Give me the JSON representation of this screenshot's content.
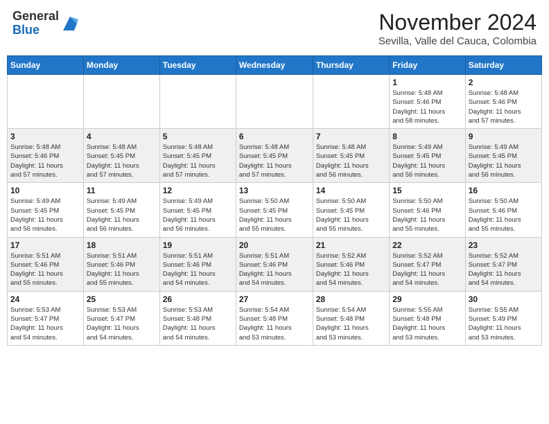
{
  "header": {
    "logo_line1": "General",
    "logo_line2": "Blue",
    "month": "November 2024",
    "location": "Sevilla, Valle del Cauca, Colombia"
  },
  "weekdays": [
    "Sunday",
    "Monday",
    "Tuesday",
    "Wednesday",
    "Thursday",
    "Friday",
    "Saturday"
  ],
  "weeks": [
    [
      {
        "day": "",
        "info": ""
      },
      {
        "day": "",
        "info": ""
      },
      {
        "day": "",
        "info": ""
      },
      {
        "day": "",
        "info": ""
      },
      {
        "day": "",
        "info": ""
      },
      {
        "day": "1",
        "info": "Sunrise: 5:48 AM\nSunset: 5:46 PM\nDaylight: 11 hours\nand 58 minutes."
      },
      {
        "day": "2",
        "info": "Sunrise: 5:48 AM\nSunset: 5:46 PM\nDaylight: 11 hours\nand 57 minutes."
      }
    ],
    [
      {
        "day": "3",
        "info": "Sunrise: 5:48 AM\nSunset: 5:46 PM\nDaylight: 11 hours\nand 57 minutes."
      },
      {
        "day": "4",
        "info": "Sunrise: 5:48 AM\nSunset: 5:45 PM\nDaylight: 11 hours\nand 57 minutes."
      },
      {
        "day": "5",
        "info": "Sunrise: 5:48 AM\nSunset: 5:45 PM\nDaylight: 11 hours\nand 57 minutes."
      },
      {
        "day": "6",
        "info": "Sunrise: 5:48 AM\nSunset: 5:45 PM\nDaylight: 11 hours\nand 57 minutes."
      },
      {
        "day": "7",
        "info": "Sunrise: 5:48 AM\nSunset: 5:45 PM\nDaylight: 11 hours\nand 56 minutes."
      },
      {
        "day": "8",
        "info": "Sunrise: 5:49 AM\nSunset: 5:45 PM\nDaylight: 11 hours\nand 56 minutes."
      },
      {
        "day": "9",
        "info": "Sunrise: 5:49 AM\nSunset: 5:45 PM\nDaylight: 11 hours\nand 56 minutes."
      }
    ],
    [
      {
        "day": "10",
        "info": "Sunrise: 5:49 AM\nSunset: 5:45 PM\nDaylight: 11 hours\nand 56 minutes."
      },
      {
        "day": "11",
        "info": "Sunrise: 5:49 AM\nSunset: 5:45 PM\nDaylight: 11 hours\nand 56 minutes."
      },
      {
        "day": "12",
        "info": "Sunrise: 5:49 AM\nSunset: 5:45 PM\nDaylight: 11 hours\nand 56 minutes."
      },
      {
        "day": "13",
        "info": "Sunrise: 5:50 AM\nSunset: 5:45 PM\nDaylight: 11 hours\nand 55 minutes."
      },
      {
        "day": "14",
        "info": "Sunrise: 5:50 AM\nSunset: 5:45 PM\nDaylight: 11 hours\nand 55 minutes."
      },
      {
        "day": "15",
        "info": "Sunrise: 5:50 AM\nSunset: 5:46 PM\nDaylight: 11 hours\nand 55 minutes."
      },
      {
        "day": "16",
        "info": "Sunrise: 5:50 AM\nSunset: 5:46 PM\nDaylight: 11 hours\nand 55 minutes."
      }
    ],
    [
      {
        "day": "17",
        "info": "Sunrise: 5:51 AM\nSunset: 5:46 PM\nDaylight: 11 hours\nand 55 minutes."
      },
      {
        "day": "18",
        "info": "Sunrise: 5:51 AM\nSunset: 5:46 PM\nDaylight: 11 hours\nand 55 minutes."
      },
      {
        "day": "19",
        "info": "Sunrise: 5:51 AM\nSunset: 5:46 PM\nDaylight: 11 hours\nand 54 minutes."
      },
      {
        "day": "20",
        "info": "Sunrise: 5:51 AM\nSunset: 5:46 PM\nDaylight: 11 hours\nand 54 minutes."
      },
      {
        "day": "21",
        "info": "Sunrise: 5:52 AM\nSunset: 5:46 PM\nDaylight: 11 hours\nand 54 minutes."
      },
      {
        "day": "22",
        "info": "Sunrise: 5:52 AM\nSunset: 5:47 PM\nDaylight: 11 hours\nand 54 minutes."
      },
      {
        "day": "23",
        "info": "Sunrise: 5:52 AM\nSunset: 5:47 PM\nDaylight: 11 hours\nand 54 minutes."
      }
    ],
    [
      {
        "day": "24",
        "info": "Sunrise: 5:53 AM\nSunset: 5:47 PM\nDaylight: 11 hours\nand 54 minutes."
      },
      {
        "day": "25",
        "info": "Sunrise: 5:53 AM\nSunset: 5:47 PM\nDaylight: 11 hours\nand 54 minutes."
      },
      {
        "day": "26",
        "info": "Sunrise: 5:53 AM\nSunset: 5:48 PM\nDaylight: 11 hours\nand 54 minutes."
      },
      {
        "day": "27",
        "info": "Sunrise: 5:54 AM\nSunset: 5:48 PM\nDaylight: 11 hours\nand 53 minutes."
      },
      {
        "day": "28",
        "info": "Sunrise: 5:54 AM\nSunset: 5:48 PM\nDaylight: 11 hours\nand 53 minutes."
      },
      {
        "day": "29",
        "info": "Sunrise: 5:55 AM\nSunset: 5:48 PM\nDaylight: 11 hours\nand 53 minutes."
      },
      {
        "day": "30",
        "info": "Sunrise: 5:55 AM\nSunset: 5:49 PM\nDaylight: 11 hours\nand 53 minutes."
      }
    ]
  ]
}
